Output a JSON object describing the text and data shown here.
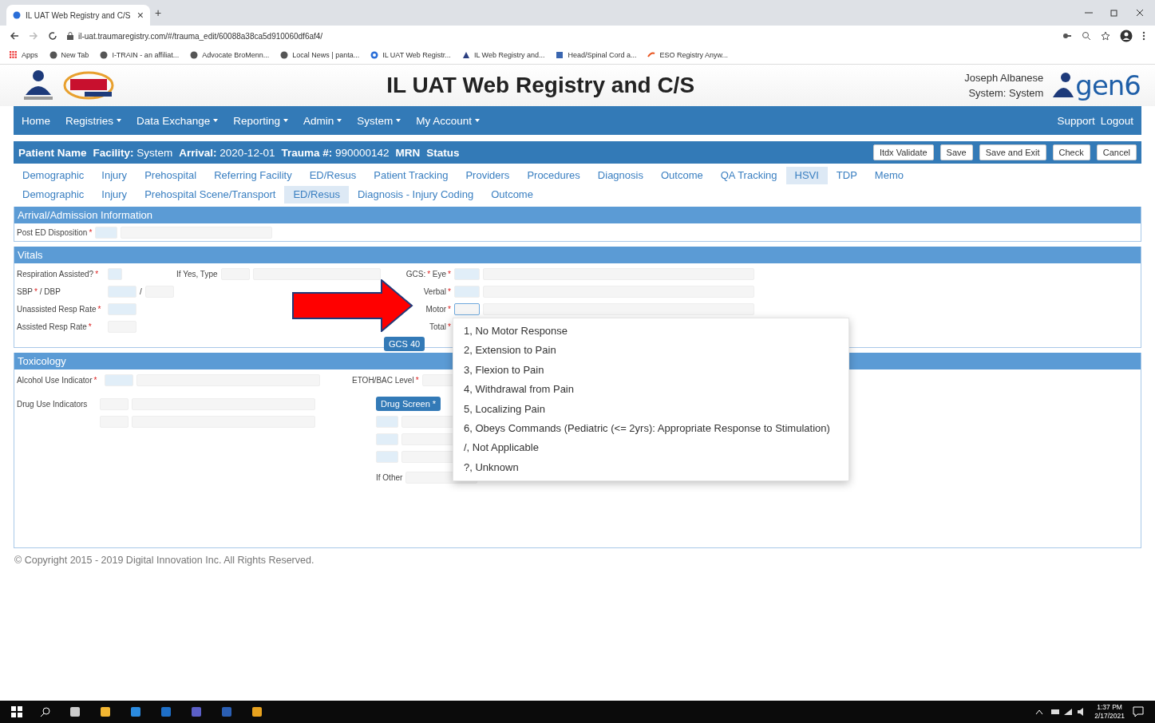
{
  "browser": {
    "tab_title": "IL UAT Web Registry and C/S",
    "tab_close": "×",
    "new_tab": "+",
    "url": "il-uat.traumaregistry.com/#/trauma_edit/60088a38ca5d910060df6af4/",
    "bookmarks": [
      {
        "label": "Apps",
        "kind": "apps"
      },
      {
        "label": "New Tab",
        "kind": "globe"
      },
      {
        "label": "I-TRAIN - an affiliat...",
        "kind": "globe"
      },
      {
        "label": "Advocate BroMenn...",
        "kind": "globe"
      },
      {
        "label": "Local News | panta...",
        "kind": "globe"
      },
      {
        "label": "IL UAT Web Registr...",
        "kind": "dot"
      },
      {
        "label": "IL Web Registry and...",
        "kind": "logo"
      },
      {
        "label": "Head/Spinal Cord a...",
        "kind": "book"
      },
      {
        "label": "ESO Registry Anyw...",
        "kind": "eso"
      }
    ]
  },
  "header": {
    "title": "IL UAT Web Registry and C/S",
    "user": "Joseph Albanese",
    "system": "System: System",
    "brand": "gen6"
  },
  "nav": {
    "items": [
      {
        "label": "Home",
        "menu": false
      },
      {
        "label": "Registries",
        "menu": true
      },
      {
        "label": "Data Exchange",
        "menu": true
      },
      {
        "label": "Reporting",
        "menu": true
      },
      {
        "label": "Admin",
        "menu": true
      },
      {
        "label": "System",
        "menu": true
      },
      {
        "label": "My Account",
        "menu": true
      }
    ],
    "right": [
      "Support",
      "Logout"
    ]
  },
  "patient_bar": {
    "fields": [
      {
        "label": "Patient Name"
      },
      {
        "label": "Facility:",
        "value": "System"
      },
      {
        "label": "Arrival:",
        "value": "2020-12-01"
      },
      {
        "label": "Trauma #:",
        "value": "990000142"
      },
      {
        "label": "MRN"
      },
      {
        "label": "Status"
      }
    ],
    "buttons": [
      "Itdx Validate",
      "Save",
      "Save and Exit",
      "Check",
      "Cancel"
    ]
  },
  "main_tabs": [
    {
      "label": "Demographic",
      "selected": false
    },
    {
      "label": "Injury",
      "selected": false
    },
    {
      "label": "Prehospital",
      "selected": false
    },
    {
      "label": "Referring Facility",
      "selected": false
    },
    {
      "label": "ED/Resus",
      "selected": false
    },
    {
      "label": "Patient Tracking",
      "selected": false
    },
    {
      "label": "Providers",
      "selected": false
    },
    {
      "label": "Procedures",
      "selected": false
    },
    {
      "label": "Diagnosis",
      "selected": false
    },
    {
      "label": "Outcome",
      "selected": false
    },
    {
      "label": "QA Tracking",
      "selected": false
    },
    {
      "label": "HSVI",
      "selected": true
    },
    {
      "label": "TDP",
      "selected": false
    },
    {
      "label": "Memo",
      "selected": false
    }
  ],
  "sub_tabs": [
    {
      "label": "Demographic",
      "selected": false
    },
    {
      "label": "Injury",
      "selected": false
    },
    {
      "label": "Prehospital Scene/Transport",
      "selected": false
    },
    {
      "label": "ED/Resus",
      "selected": true
    },
    {
      "label": "Diagnosis - Injury Coding",
      "selected": false
    },
    {
      "label": "Outcome",
      "selected": false
    }
  ],
  "arrival": {
    "title": "Arrival/Admission Information",
    "fields": [
      {
        "label": "Post ED Disposition",
        "mark": "*"
      }
    ]
  },
  "vitals": {
    "title": "Vitals",
    "left": [
      {
        "label": "Respiration Assisted?",
        "mark": "*",
        "extra_label": "If Yes, Type"
      },
      {
        "label": "SBP",
        "mark": "*",
        "suffix": "/ DBP",
        "separator": "/"
      },
      {
        "label": "Unassisted Resp Rate",
        "mark": "*"
      },
      {
        "label": "Assisted Resp Rate",
        "mark": "*"
      }
    ],
    "gcs": [
      {
        "prefix": "GCS:",
        "prefix_mark": "*",
        "label": "Eye",
        "mark": "*",
        "focused": false
      },
      {
        "label": "Verbal",
        "mark": "*",
        "focused": false
      },
      {
        "label": "Motor",
        "mark": "*",
        "focused": true
      },
      {
        "label": "Total",
        "mark": "*"
      }
    ],
    "gcs_button": "GCS 40"
  },
  "toxicology": {
    "title": "Toxicology",
    "alcohol": {
      "label": "Alcohol Use Indicator",
      "mark": "*"
    },
    "etoh": {
      "label": "ETOH/BAC Level",
      "mark": "*"
    },
    "drug": {
      "label": "Drug Use Indicators"
    },
    "drug_screen": "Drug Screen *",
    "if_other": "If Other"
  },
  "dropdown": {
    "options": [
      "1, No Motor Response",
      "2, Extension to Pain",
      "3, Flexion to Pain",
      "4, Withdrawal from Pain",
      "5, Localizing Pain",
      "6, Obeys Commands (Pediatric (<= 2yrs): Appropriate Response to Stimulation)",
      "/, Not Applicable",
      "?, Unknown"
    ]
  },
  "copyright": "© Copyright 2015 - 2019 Digital Innovation Inc. All Rights Reserved.",
  "taskbar": {
    "time": "1:37 PM",
    "date": "2/17/2021"
  }
}
